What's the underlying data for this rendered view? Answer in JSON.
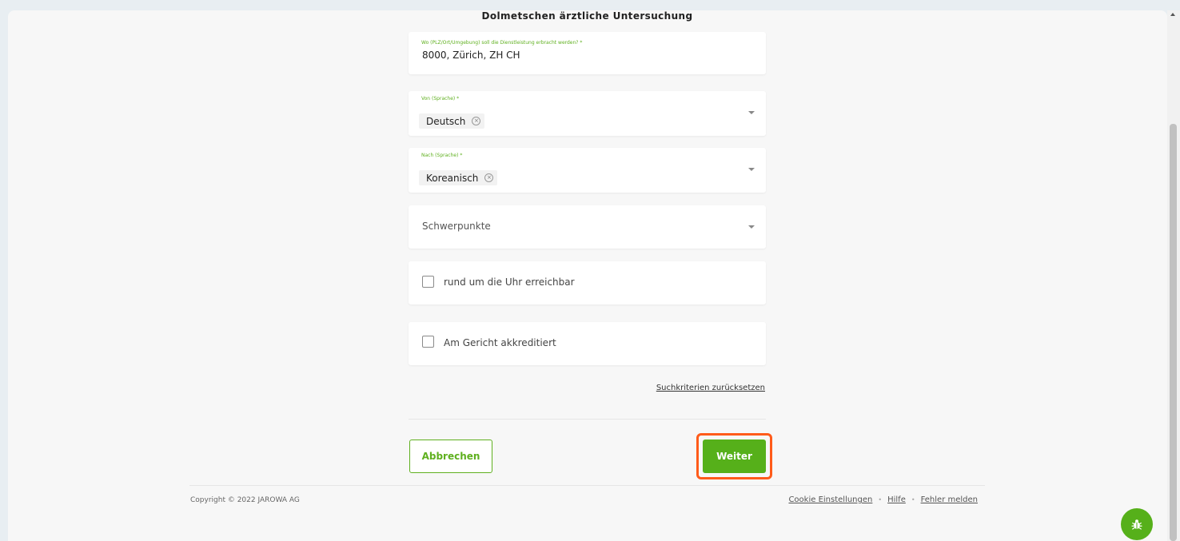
{
  "page": {
    "title": "Dolmetschen ärztliche Untersuchung"
  },
  "location_field": {
    "label": "Wo (PLZ/Ort/Umgebung) soll die Dienstleistung erbracht werden? *",
    "value": "8000, Zürich, ZH CH"
  },
  "from_language": {
    "label": "Von (Sprache) *",
    "chip": "Deutsch"
  },
  "to_language": {
    "label": "Nach (Sprache) *",
    "chip": "Koreanisch"
  },
  "focus": {
    "placeholder": "Schwerpunkte"
  },
  "checkboxes": {
    "around_clock": {
      "label": "rund um die Uhr erreichbar",
      "checked": false
    },
    "court_accredited": {
      "label": "Am Gericht akkreditiert",
      "checked": false
    }
  },
  "reset_link": "Suchkriterien zurücksetzen",
  "buttons": {
    "cancel": "Abbrechen",
    "next": "Weiter"
  },
  "footer": {
    "copyright": "Copyright © 2022 JAROWA AG",
    "links": [
      "Cookie Einstellungen",
      "Hilfe",
      "Fehler melden"
    ]
  },
  "colors": {
    "accent": "#56b01a",
    "highlight": "#ff5b1a"
  },
  "icons": {
    "chip_remove": "circle-x-icon",
    "dropdown": "chevron-down-icon",
    "fab": "bug-icon"
  }
}
